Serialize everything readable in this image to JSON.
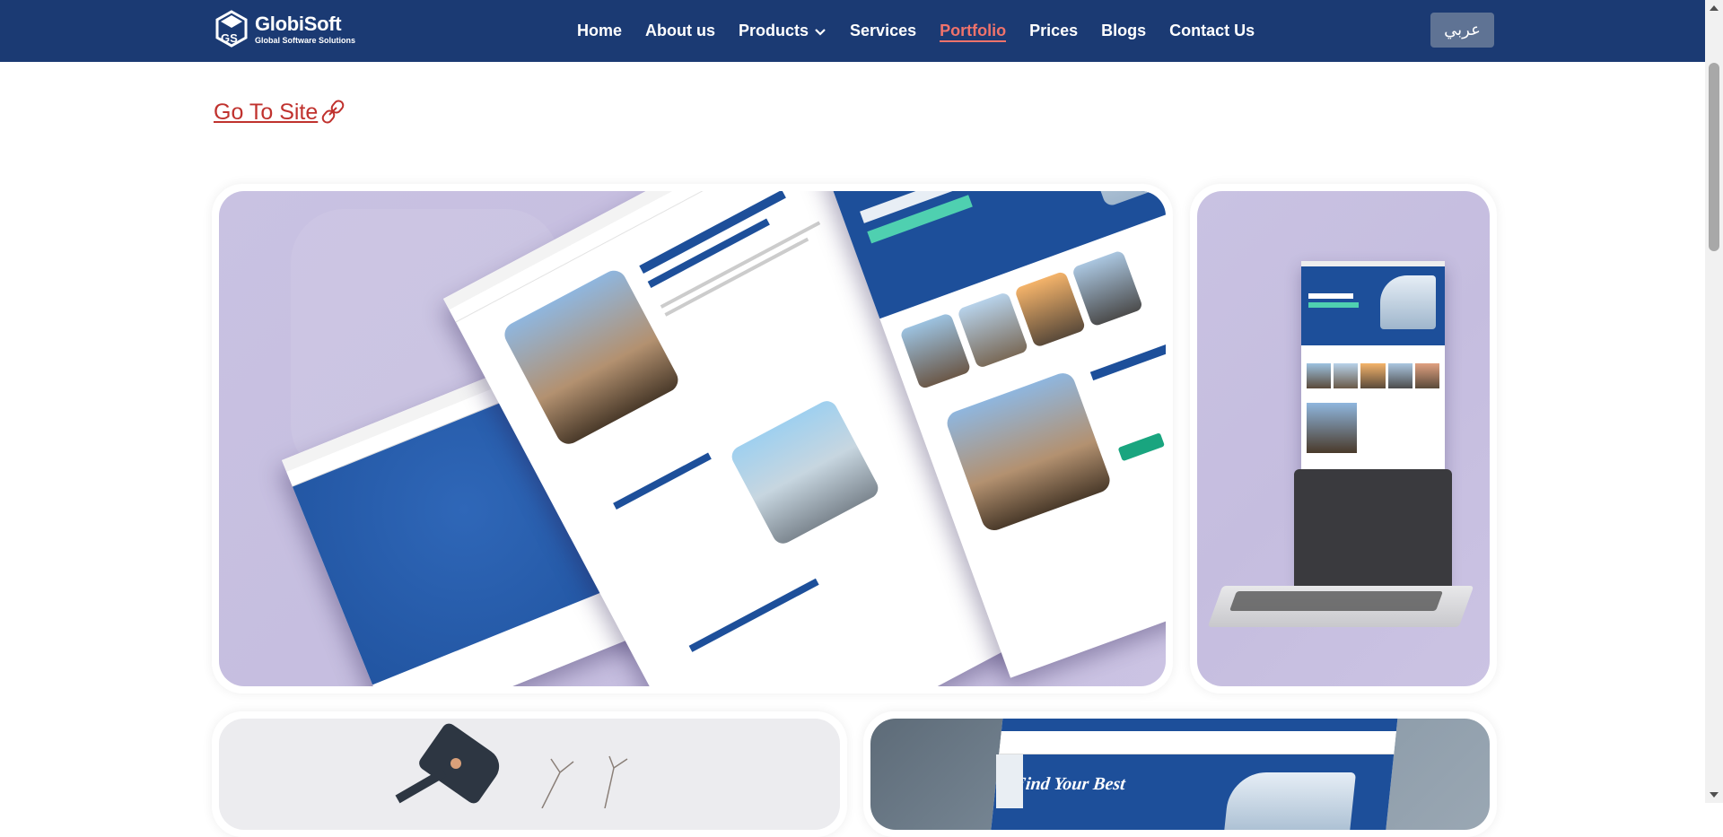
{
  "brand": {
    "name": "GlobiSoft",
    "tagline": "Global Software Solutions"
  },
  "nav": {
    "items": [
      {
        "label": "Home"
      },
      {
        "label": "About us"
      },
      {
        "label": "Products"
      },
      {
        "label": "Services"
      },
      {
        "label": "Portfolio"
      },
      {
        "label": "Prices"
      },
      {
        "label": "Blogs"
      },
      {
        "label": "Contact Us"
      }
    ],
    "active": "Portfolio"
  },
  "language_button": "عربي",
  "goto_site_label": "Go To Site",
  "gallery": {
    "items": [
      {
        "name": "real-estate-multi-page-mockup"
      },
      {
        "name": "real-estate-laptop-mockup"
      },
      {
        "name": "desk-lamp-photo"
      },
      {
        "name": "real-estate-desktop-mockup",
        "headline": "Find Your Best"
      }
    ]
  },
  "colors": {
    "navbar_bg": "#1b3a73",
    "active_nav": "#f0736b",
    "goto_link": "#c0322e",
    "lang_button_bg": "#5f7394"
  }
}
